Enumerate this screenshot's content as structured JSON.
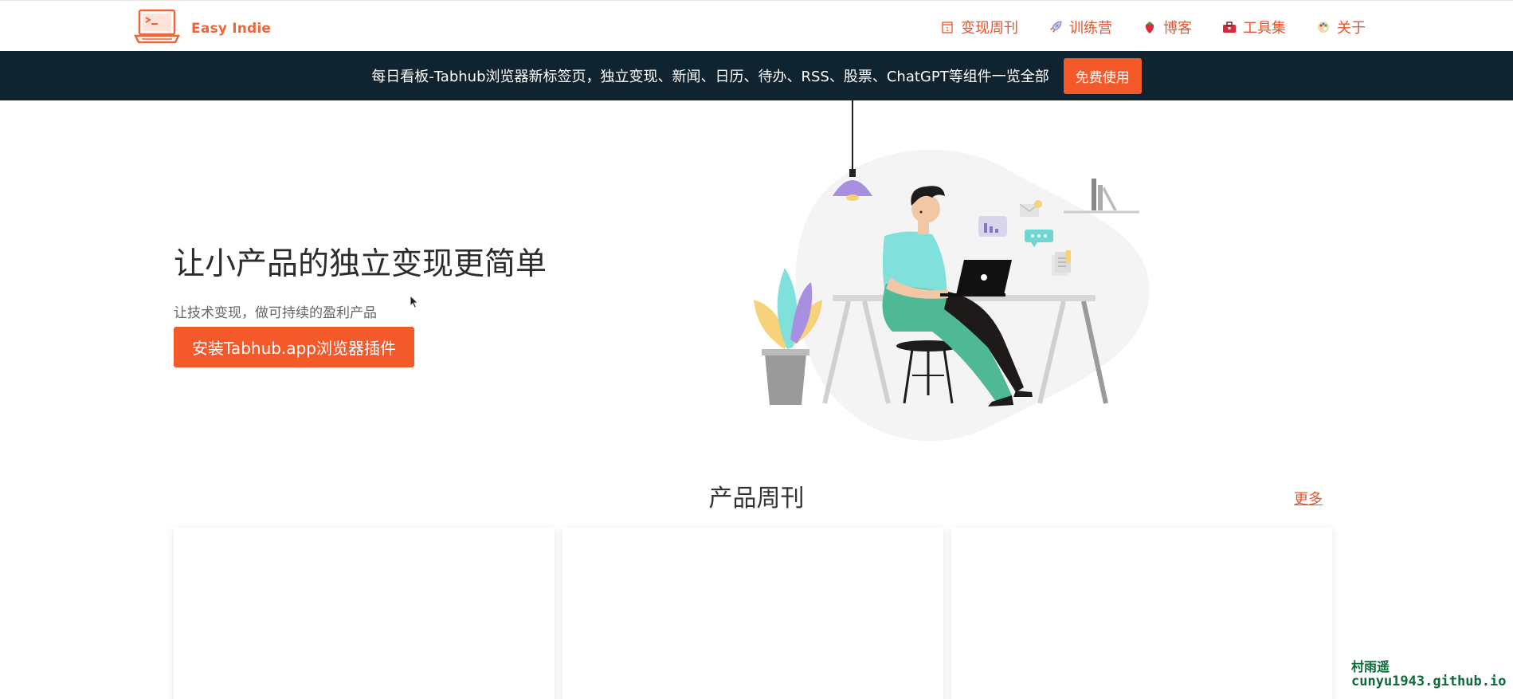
{
  "header": {
    "brand": "Easy Indie",
    "nav": [
      {
        "label": "变现周刊",
        "icon": "calendar-icon"
      },
      {
        "label": "训练营",
        "icon": "rocket-icon"
      },
      {
        "label": "博客",
        "icon": "strawberry-icon"
      },
      {
        "label": "工具集",
        "icon": "toolbox-icon"
      },
      {
        "label": "关于",
        "icon": "palette-icon"
      }
    ]
  },
  "banner": {
    "text": "每日看板-Tabhub浏览器新标签页，独立变现、新闻、日历、待办、RSS、股票、ChatGPT等组件一览全部",
    "button": "免费使用"
  },
  "hero": {
    "title": "让小产品的独立变现更简单",
    "subtitle": "让技术变现，做可持续的盈利产品",
    "cta": "安装Tabhub.app浏览器插件"
  },
  "section": {
    "title": "产品周刊",
    "more": "更多"
  },
  "watermark": {
    "line1": "村雨遥",
    "line2": "cunyu1943.github.io"
  },
  "colors": {
    "accent": "#f4592a",
    "nav_text": "#e8542b",
    "banner_bg": "#0f2330"
  }
}
